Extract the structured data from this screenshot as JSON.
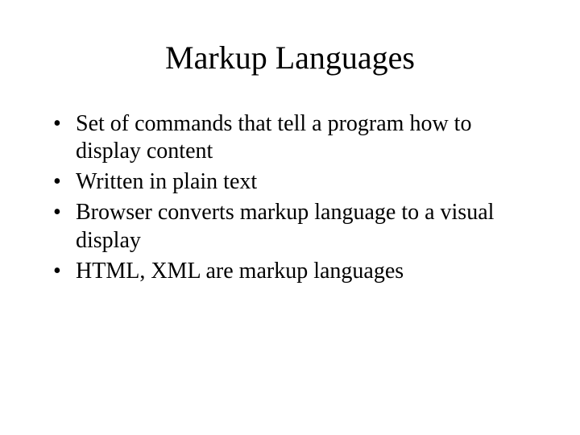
{
  "title": "Markup Languages",
  "bullets": [
    "Set of commands that tell a program how to display content",
    "Written in plain text",
    "Browser converts markup language to a visual display",
    "HTML, XML are markup languages"
  ]
}
